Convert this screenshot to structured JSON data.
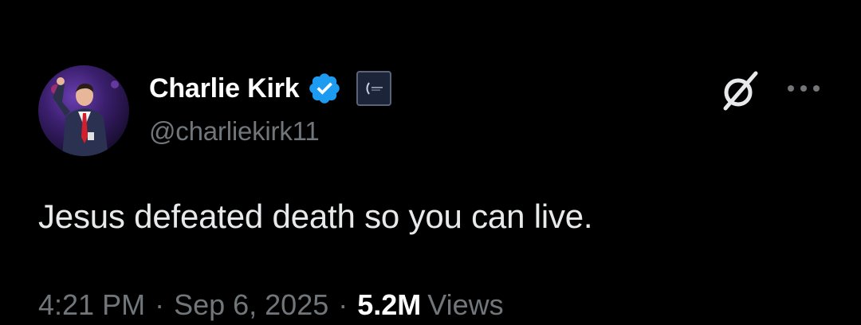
{
  "author": {
    "display_name": "Charlie Kirk",
    "handle": "@charliekirk11",
    "verified": true,
    "verified_badge_color": "#1d9bf0",
    "affiliate_badge_icon": "organization-logo-icon"
  },
  "post": {
    "text": "Jesus defeated death so you can live.",
    "time": "4:21 PM",
    "separator": "·",
    "date": "Sep 6, 2025",
    "views_count": "5.2M",
    "views_label": "Views"
  },
  "actions": {
    "grok_icon": "grok-icon",
    "more_icon": "more-options-icon"
  },
  "colors": {
    "background": "#000000",
    "primary_text": "#e7e9ea",
    "secondary_text": "#71767b",
    "accent": "#1d9bf0"
  }
}
